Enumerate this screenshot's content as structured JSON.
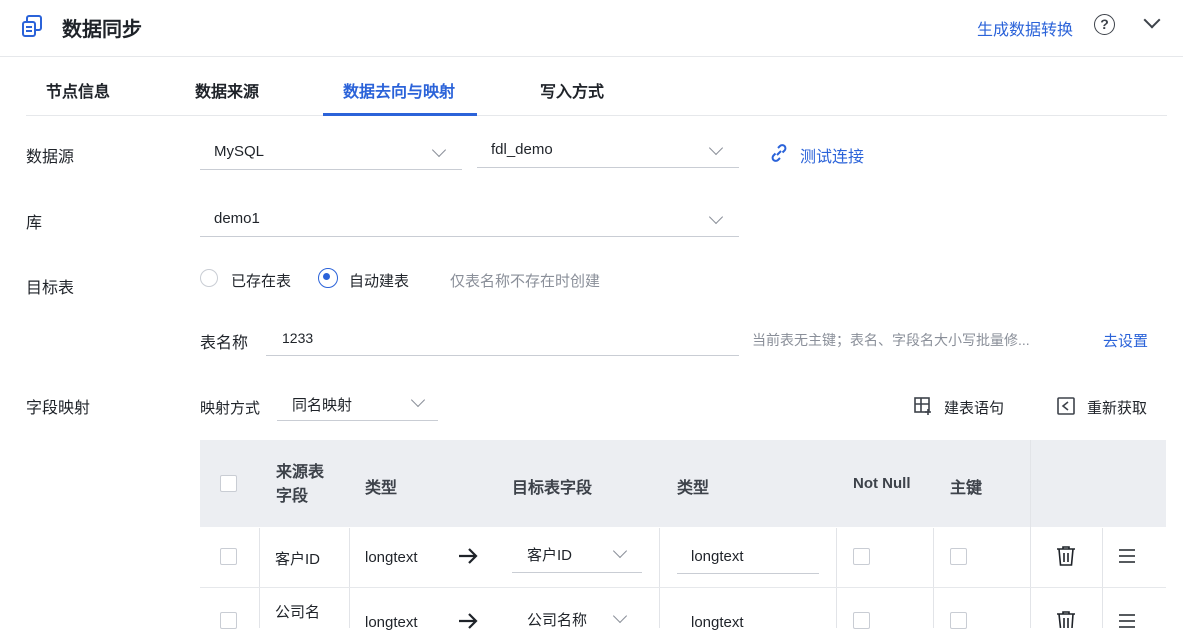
{
  "app": {
    "title": "数据同步",
    "convert_link": "生成数据转换"
  },
  "tabs": [
    "节点信息",
    "数据来源",
    "数据去向与映射",
    "写入方式"
  ],
  "form": {
    "datasource_label": "数据源",
    "datasource_type": "MySQL",
    "datasource_conn": "fdl_demo",
    "test_connection": "测试连接",
    "db_label": "库",
    "db_value": "demo1",
    "target_label": "目标表",
    "radio_existing": "已存在表",
    "radio_auto": "自动建表",
    "auto_hint": "仅表名称不存在时创建",
    "tablename_label": "表名称",
    "tablename_value": "1233",
    "pk_warning": "当前表无主键；表名、字段名大小写批量修...",
    "go_settings": "去设置"
  },
  "mapping": {
    "section_label": "字段映射",
    "method_label": "映射方式",
    "method_value": "同名映射",
    "ddl_button": "建表语句",
    "refetch_button": "重新获取"
  },
  "table": {
    "headers": {
      "src_field": "来源表字段",
      "src_type": "类型",
      "dst_field": "目标表字段",
      "dst_type": "类型",
      "not_null": "Not Null",
      "pk": "主键"
    },
    "rows": [
      {
        "src_field": "客户ID",
        "src_type": "longtext",
        "dst_field": "客户ID",
        "dst_type": "longtext"
      },
      {
        "src_field": "公司名",
        "src_type": "longtext",
        "dst_field": "公司名称",
        "dst_type": "longtext"
      }
    ]
  },
  "colors": {
    "accent": "#2b63d9",
    "header_bg": "#eceef2"
  }
}
